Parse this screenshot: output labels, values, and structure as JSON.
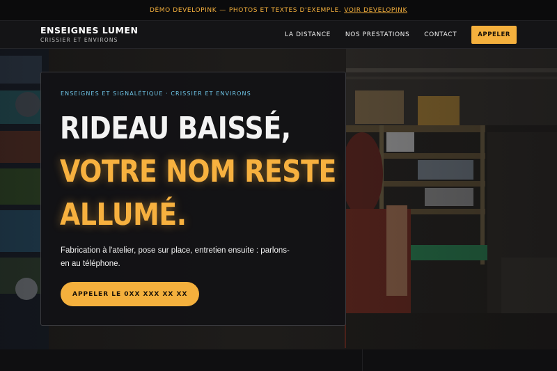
{
  "announcement": {
    "text": "DÉMO DEVELOPINK",
    "separator": "—",
    "detail": "PHOTOS ET TEXTES D'EXEMPLE.",
    "link_label": "VOIR DEVELOPINK"
  },
  "brand": {
    "name": "ENSEIGNES LUMEN",
    "tagline": "CRISSIER ET ENVIRONS"
  },
  "nav": {
    "items": [
      {
        "label": "LA DISTANCE"
      },
      {
        "label": "NOS PRESTATIONS"
      },
      {
        "label": "CONTACT"
      }
    ],
    "cta_label": "APPELER"
  },
  "hero": {
    "eyebrow": "ENSEIGNES ET SIGNALÉTIQUE · CRISSIER ET ENVIRONS",
    "headline_line1": "RIDEAU BAISSÉ,",
    "headline_line2": "VOTRE NOM RESTE",
    "headline_line3": "ALLUMÉ.",
    "lede": "Fabrication à l'atelier, pose sur place, entretien ensuite : parlons-en au téléphone.",
    "cta_label": "APPELER LE 0XX XXX XX XX"
  },
  "colors": {
    "accent": "#f4b03d",
    "eyebrow": "#6fc6e8",
    "background": "#0d0d0e"
  }
}
